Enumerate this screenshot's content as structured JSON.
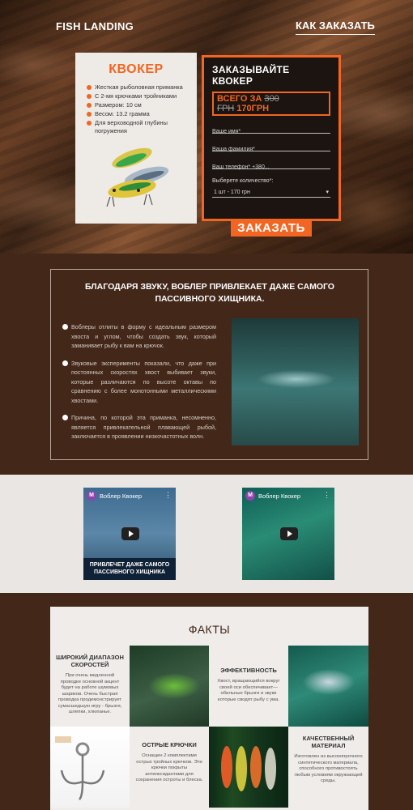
{
  "nav": {
    "logo": "FISH LANDING",
    "howto": "КАК ЗАКАЗАТЬ"
  },
  "product": {
    "name": "КВОКЕР",
    "features": [
      "Жесткая рыболовная приманка",
      "С 2-мя крючками тройниками",
      "Размером: 10 см",
      "Весом: 13.2 грамма",
      "Для верховодной глубины погружения"
    ]
  },
  "order": {
    "title": "ЗАКАЗЫВАЙТЕ КВОКЕР",
    "price_prefix": "ВСЕГО ЗА",
    "old_price": "300 ГРН",
    "new_price": "170ГРН",
    "name_placeholder": "Ваше имя*",
    "surname_placeholder": "Ваша фамилия*",
    "phone_placeholder": "Ваш телефон* +380...",
    "qty_label": "Выберете количество*:",
    "qty_selected": "1 шт - 170 грн",
    "button": "ЗАКАЗАТЬ"
  },
  "sound": {
    "heading": "БЛАГОДАРЯ ЗВУКУ, ВОБЛЕР ПРИВЛЕКАЕТ ДАЖЕ САМОГО ПАССИВНОГО ХИЩНИКА.",
    "points": [
      "Воблеры отлиты в форму с идеальным размером хвоста и углом, чтобы создать звук, который заманивает рыбу к вам на крючок.",
      "Звуковые эксперименты показали, что даже при постоянных скоростях хвост выбивает звуки, которые различаются по высоте октавы по сравнению с более монотонными металлическими хвостами.",
      "Причина, по которой эта приманка, несомненно, является привлекательной плавающей рыбой, заключается в проявлении низкочастотных волн."
    ]
  },
  "videos": [
    {
      "avatar": "M",
      "title": "Воблер Квокер",
      "caption": "ПРИВЛЕЧЕТ ДАЖЕ САМОГО ПАССИВНОГО ХИЩНИКА"
    },
    {
      "avatar": "M",
      "title": "Воблер Квокер"
    }
  ],
  "facts": {
    "title": "ФАКТЫ",
    "items": [
      {
        "title": "ШИРОКИЙ ДИАПАЗОН СКОРОСТЕЙ",
        "text": "При очень медленной проводке основной акцент будет на работе шумовых шариков. Очень быстрая проводка продемонстрирует сумасшедшую игру - брызги, шлепки, хлюпанье."
      },
      {
        "title": "ЭФФЕКТИВНОСТЬ",
        "text": "Хвост, вращающийся вокруг своей оси обеспечивает— обильные брызги и звуки которые сводят рыбу с ума."
      },
      {
        "title": "ОСТРЫЕ КРЮЧКИ",
        "text": "Оснащен 2 комплектами острых тройных крючков. Эти крючки покрыты антиоксидантами для сохранения остроты и блеска."
      },
      {
        "title": "КАЧЕСТВЕННЫЙ МАТЕРИАЛ",
        "text": "Изготовлен из высокопрочного синтетического материала, способного противостоять любым условиям окружающей среды."
      }
    ]
  },
  "colors": {
    "accent": "#f26522",
    "dark_brown": "#43281a",
    "light_bg": "#e9e6e3"
  }
}
